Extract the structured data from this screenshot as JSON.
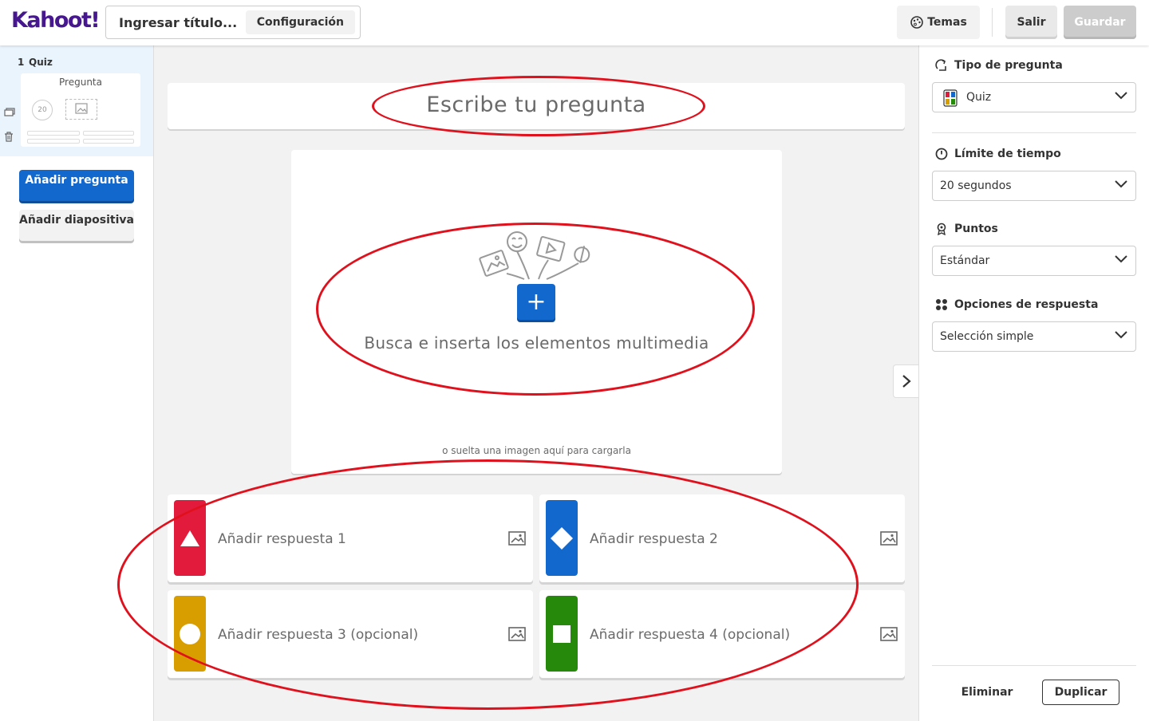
{
  "header": {
    "logo": "Kahoot!",
    "title_placeholder": "Ingresar título...",
    "config_label": "Configuración",
    "temas_label": "Temas",
    "salir_label": "Salir",
    "guardar_label": "Guardar"
  },
  "sidebar": {
    "slide_number": "1",
    "slide_type": "Quiz",
    "thumb_title": "Pregunta",
    "thumb_timer": "20",
    "add_question_label": "Añadir pregunta",
    "add_slide_label": "Añadir diapositiva"
  },
  "main": {
    "question_placeholder": "Escribe tu pregunta",
    "media_label": "Busca e inserta los elementos multimedia",
    "media_drop_label": "o suelta una imagen aquí para cargarla",
    "answers": [
      {
        "label": "Añadir respuesta 1",
        "color": "#e21b3c",
        "shape": "triangle"
      },
      {
        "label": "Añadir respuesta 2",
        "color": "#1368ce",
        "shape": "diamond"
      },
      {
        "label": "Añadir respuesta 3 (opcional)",
        "color": "#d89e00",
        "shape": "circle"
      },
      {
        "label": "Añadir respuesta 4 (opcional)",
        "color": "#26890c",
        "shape": "square"
      }
    ]
  },
  "panel": {
    "question_type_label": "Tipo de pregunta",
    "question_type_value": "Quiz",
    "time_limit_label": "Límite de tiempo",
    "time_limit_value": "20 segundos",
    "points_label": "Puntos",
    "points_value": "Estándar",
    "answer_options_label": "Opciones de respuesta",
    "answer_options_value": "Selección simple",
    "delete_label": "Eliminar",
    "duplicate_label": "Duplicar"
  },
  "colors": {
    "brand_purple": "#46178f",
    "primary_blue": "#1368ce",
    "annotation_red": "#e0101c"
  }
}
